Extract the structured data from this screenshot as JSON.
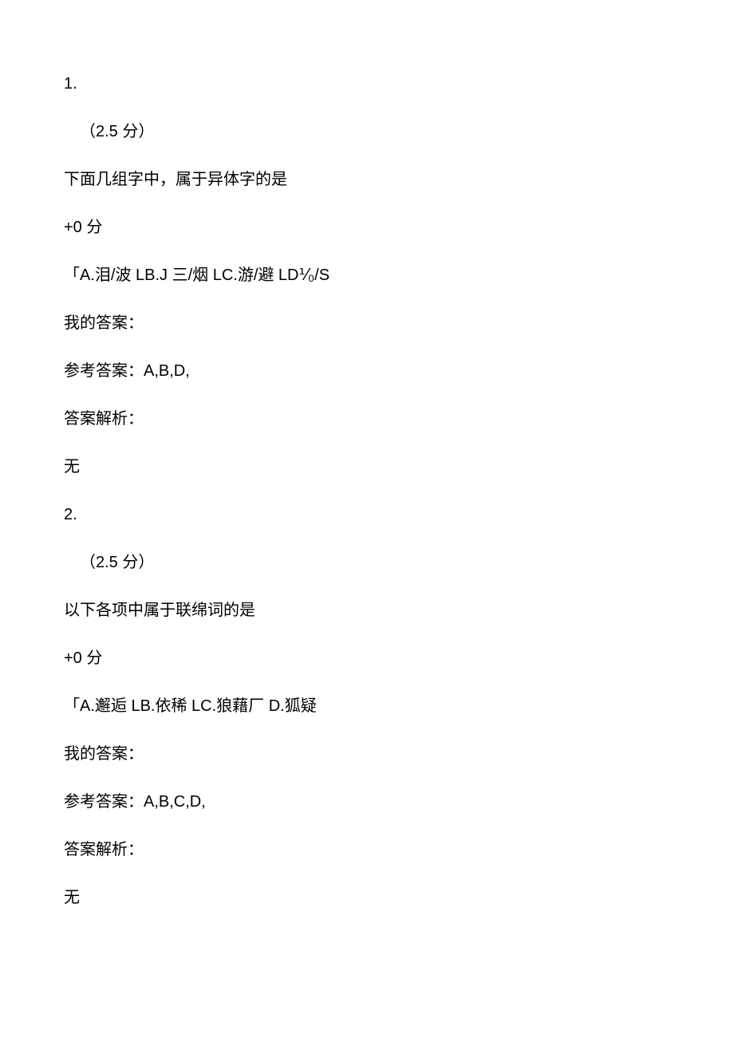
{
  "questions": [
    {
      "number": "1.",
      "points": "（2.5 分）",
      "prompt": "下面几组字中，属于异体字的是",
      "score": "+0 分",
      "options": "「A.泪/波 LB.J 三/烟 LC.游/避 LD⅟₀/S",
      "my_answer_label": "我的答案：",
      "ref_answer_label": "参考答案：A,B,D,",
      "analysis_label": "答案解析：",
      "analysis_content": "无"
    },
    {
      "number": "2.",
      "points": "（2.5 分）",
      "prompt": "以下各项中属于联绵词的是",
      "score": "+0 分",
      "options": "「A.邂逅 LB.依稀 LC.狼藉厂 D.狐疑",
      "my_answer_label": "我的答案：",
      "ref_answer_label": "参考答案：A,B,C,D,",
      "analysis_label": "答案解析：",
      "analysis_content": "无"
    }
  ]
}
